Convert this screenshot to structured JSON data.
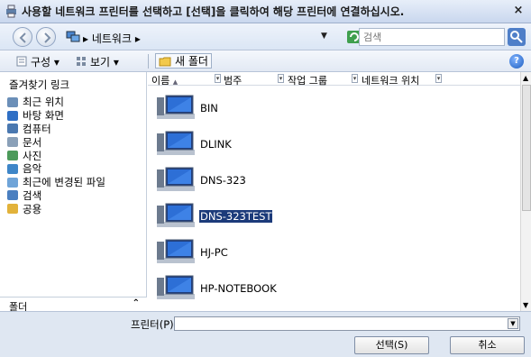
{
  "window": {
    "title": "사용할 네트워크 프린터를 선택하고 [선택]을 클릭하여 해당 프린터에 연결하십시오.",
    "close_symbol": "×"
  },
  "address_bar": {
    "path": "▸ 네트워크 ▸",
    "search_placeholder": "검색"
  },
  "toolbar": {
    "organize_label": "구성 ▾",
    "view_label": "보기 ▾",
    "new_folder_label": "새 폴더",
    "help_symbol": "?"
  },
  "sidebar": {
    "heading": "즐겨찾기 링크",
    "items": [
      {
        "label": "최근 위치",
        "icon": "recent-places-icon",
        "color": "#6b8fb8"
      },
      {
        "label": "바탕 화면",
        "icon": "desktop-icon",
        "color": "#2f6fc5"
      },
      {
        "label": "컴퓨터",
        "icon": "computer-icon",
        "color": "#4a78b0"
      },
      {
        "label": "문서",
        "icon": "documents-icon",
        "color": "#8aa0b8"
      },
      {
        "label": "사진",
        "icon": "pictures-icon",
        "color": "#4c9a5a"
      },
      {
        "label": "음악",
        "icon": "music-icon",
        "color": "#3e86c8"
      },
      {
        "label": "최근에 변경된 파일",
        "icon": "recent-files-icon",
        "color": "#6fa4d8"
      },
      {
        "label": "검색",
        "icon": "search-folder-icon",
        "color": "#4a7fc0"
      },
      {
        "label": "공용",
        "icon": "public-folder-icon",
        "color": "#e2b23a"
      }
    ],
    "folders_label": "폴더",
    "folders_chevron": "⌃"
  },
  "columns": [
    {
      "label": "이름"
    },
    {
      "label": "범주"
    },
    {
      "label": "작업 그룹"
    },
    {
      "label": "네트워크 위치"
    }
  ],
  "sort_arrow": "▲",
  "column_dropdown_symbol": "▾",
  "computers": [
    {
      "name": "BIN",
      "selected": false
    },
    {
      "name": "DLINK",
      "selected": false
    },
    {
      "name": "DNS-323",
      "selected": false
    },
    {
      "name": "DNS-323TEST",
      "selected": true
    },
    {
      "name": "HJ-PC",
      "selected": false
    },
    {
      "name": "HP-NOTEBOOK",
      "selected": false
    }
  ],
  "footer": {
    "printer_label": "프린터(P)",
    "printer_value": "",
    "select_button": "선택(S)",
    "cancel_button": "취소"
  }
}
